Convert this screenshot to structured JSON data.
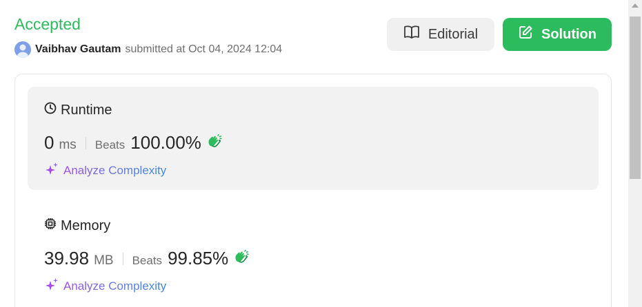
{
  "status": {
    "title": "Accepted",
    "color": "#2cbb5d"
  },
  "submission": {
    "username": "Vaibhav Gautam",
    "submitted_text": "submitted at Oct 04, 2024 12:04",
    "avatar_icon": "user-avatar-icon"
  },
  "buttons": {
    "editorial_label": "Editorial",
    "editorial_icon": "book-open-icon",
    "solution_label": "Solution",
    "solution_icon": "edit-square-icon",
    "solution_color": "#2cbb5d"
  },
  "runtime": {
    "label": "Runtime",
    "icon": "clock-icon",
    "value": "0",
    "unit": "ms",
    "beats_label": "Beats",
    "beats_percent": "100.00%",
    "badge_icon": "clap-icon",
    "analyze_label": "Analyze Complexity",
    "analyze_icon": "sparkle-icon"
  },
  "memory": {
    "label": "Memory",
    "icon": "chip-icon",
    "value": "39.98",
    "unit": "MB",
    "beats_label": "Beats",
    "beats_percent": "99.85%",
    "badge_icon": "clap-icon",
    "analyze_label": "Analyze Complexity",
    "analyze_icon": "sparkle-icon"
  },
  "scrollbar": {
    "position_fraction": 0.0
  }
}
